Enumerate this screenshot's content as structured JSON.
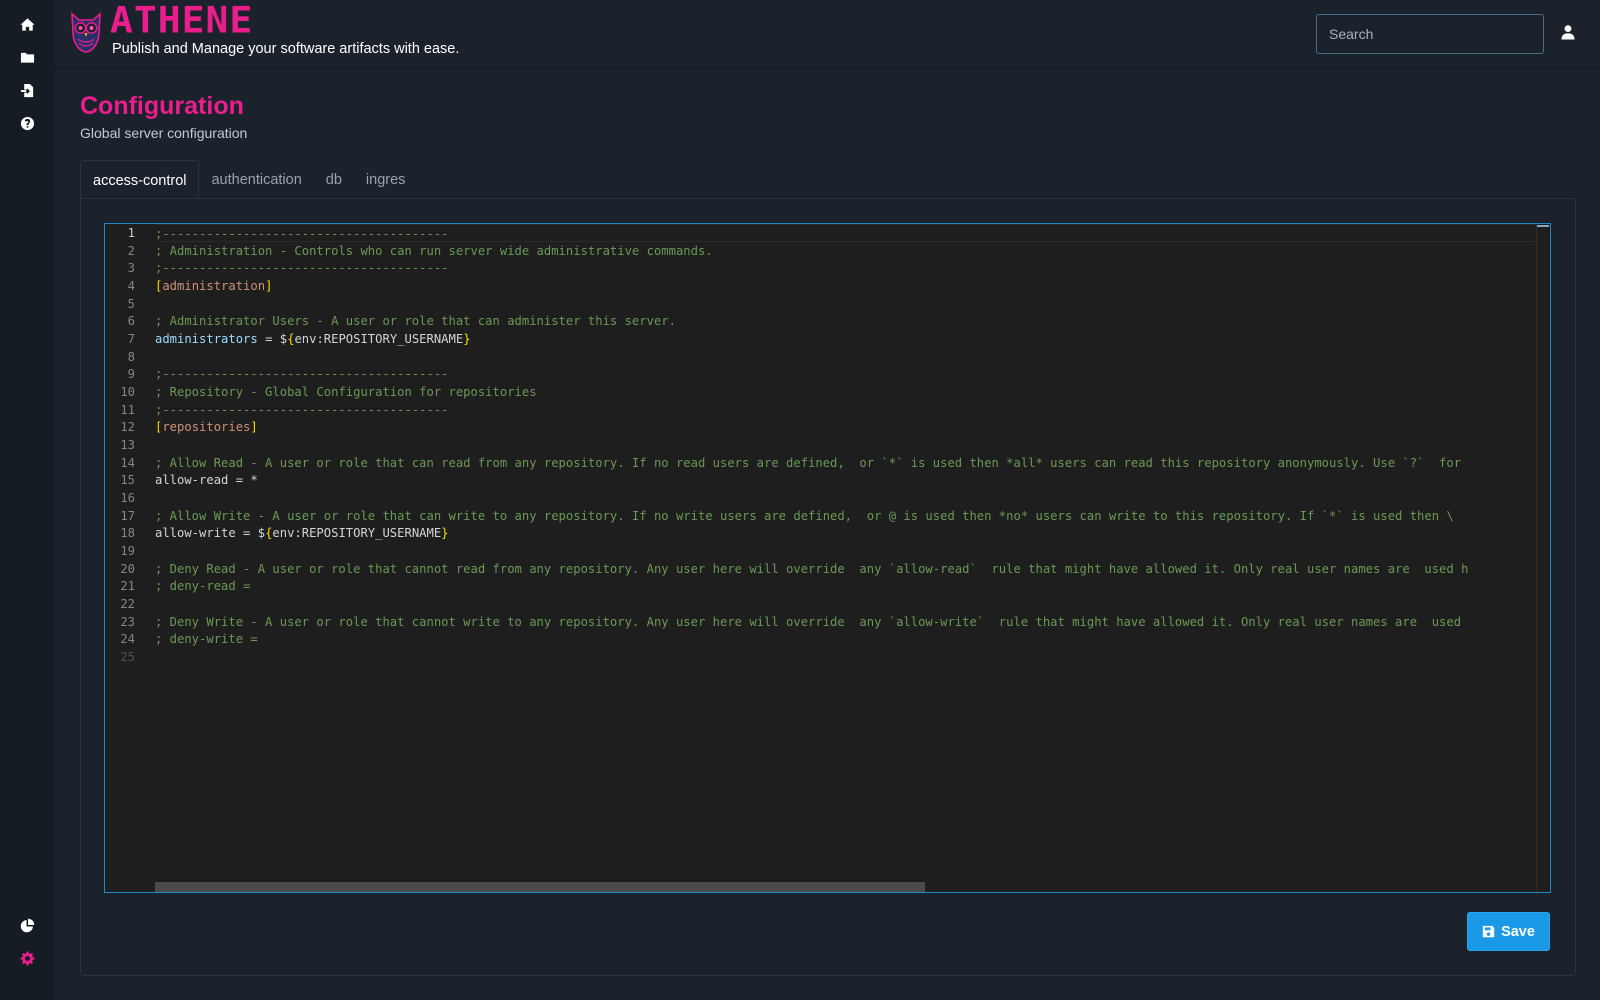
{
  "app": {
    "brand": "ATHENE",
    "tagline": "Publish and Manage your software artifacts with ease."
  },
  "search": {
    "placeholder": "Search",
    "value": ""
  },
  "sidebar": {
    "items": [
      {
        "name": "home",
        "icon": "home-icon"
      },
      {
        "name": "folders",
        "icon": "folder-icon"
      },
      {
        "name": "import",
        "icon": "file-import-icon"
      },
      {
        "name": "help",
        "icon": "question-circle-icon"
      },
      {
        "name": "statistics",
        "icon": "pie-chart-icon"
      },
      {
        "name": "configuration",
        "icon": "gear-icon",
        "active": true
      }
    ]
  },
  "page": {
    "title": "Configuration",
    "subtitle": "Global server configuration"
  },
  "tabs": [
    {
      "label": "access-control",
      "active": true
    },
    {
      "label": "authentication",
      "active": false
    },
    {
      "label": "db",
      "active": false
    },
    {
      "label": "ingres",
      "active": false
    }
  ],
  "editor": {
    "line_numbers": [
      "1",
      "2",
      "3",
      "4",
      "5",
      "6",
      "7",
      "8",
      "9",
      "10",
      "11",
      "12",
      "13",
      "14",
      "15",
      "16",
      "17",
      "18",
      "19",
      "20",
      "21",
      "22",
      "23",
      "24",
      "25"
    ],
    "lines": [
      [
        {
          "t": "comment",
          "v": ";---------------------------------------"
        }
      ],
      [
        {
          "t": "comment",
          "v": "; Administration - Controls who can run server wide administrative commands."
        }
      ],
      [
        {
          "t": "comment",
          "v": ";---------------------------------------"
        }
      ],
      [
        {
          "t": "br",
          "v": "["
        },
        {
          "t": "sec",
          "v": "administration"
        },
        {
          "t": "br",
          "v": "]"
        }
      ],
      [],
      [
        {
          "t": "comment",
          "v": "; Administrator Users - A user or role that can administer this server."
        }
      ],
      [
        {
          "t": "key",
          "v": "administrators"
        },
        {
          "t": "plain",
          "v": " = $"
        },
        {
          "t": "brace",
          "v": "{"
        },
        {
          "t": "plain",
          "v": "env:REPOSITORY_USERNAME"
        },
        {
          "t": "brace",
          "v": "}"
        }
      ],
      [],
      [
        {
          "t": "comment",
          "v": ";---------------------------------------"
        }
      ],
      [
        {
          "t": "comment",
          "v": "; Repository - Global Configuration for repositories"
        }
      ],
      [
        {
          "t": "comment",
          "v": ";---------------------------------------"
        }
      ],
      [
        {
          "t": "br",
          "v": "["
        },
        {
          "t": "sec",
          "v": "repositories"
        },
        {
          "t": "br",
          "v": "]"
        }
      ],
      [],
      [
        {
          "t": "comment",
          "v": "; Allow Read - A user or role that can read from any repository. If no read users are defined,  or `*` is used then *all* users can read this repository anonymously. Use `?`  for"
        }
      ],
      [
        {
          "t": "plain",
          "v": "allow-read = *"
        }
      ],
      [],
      [
        {
          "t": "comment",
          "v": "; Allow Write - A user or role that can write to any repository. If no write users are defined,  or @ is used then *no* users can write to this repository. If `*` is used then \\"
        }
      ],
      [
        {
          "t": "plain",
          "v": "allow-write = $"
        },
        {
          "t": "brace",
          "v": "{"
        },
        {
          "t": "plain",
          "v": "env:REPOSITORY_USERNAME"
        },
        {
          "t": "brace",
          "v": "}"
        }
      ],
      [],
      [
        {
          "t": "comment",
          "v": "; Deny Read - A user or role that cannot read from any repository. Any user here will override  any `allow-read`  rule that might have allowed it. Only real user names are  used h"
        }
      ],
      [
        {
          "t": "comment",
          "v": "; deny-read ="
        }
      ],
      [],
      [
        {
          "t": "comment",
          "v": "; Deny Write - A user or role that cannot write to any repository. Any user here will override  any `allow-write`  rule that might have allowed it. Only real user names are  used"
        }
      ],
      [
        {
          "t": "comment",
          "v": "; deny-write ="
        }
      ],
      []
    ]
  },
  "actions": {
    "save_label": "Save"
  },
  "colors": {
    "accent": "#e91e8c",
    "primary_button": "#1a9ae6",
    "editor_border": "#1f86c9"
  }
}
